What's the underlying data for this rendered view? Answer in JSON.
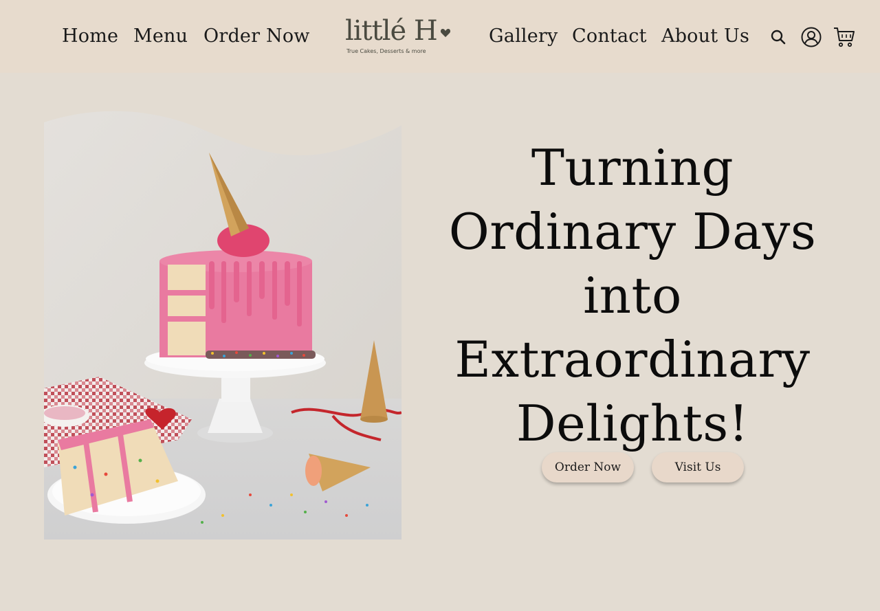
{
  "header": {
    "nav_left": [
      {
        "label": "Home"
      },
      {
        "label": "Menu"
      },
      {
        "label": "Order Now"
      }
    ],
    "nav_right": [
      {
        "label": "Gallery"
      },
      {
        "label": "Contact"
      },
      {
        "label": "About Us"
      }
    ],
    "logo": {
      "wordmark": "littlé H",
      "tagline": "True Cakes, Desserts & more"
    },
    "icons": [
      "search-icon",
      "account-icon",
      "cart-icon"
    ]
  },
  "hero": {
    "title": "Turning Ordinary Days into Extraordinary Delights!",
    "buttons": {
      "order_label": "Order Now",
      "visit_label": "Visit Us"
    }
  },
  "colors": {
    "background": "#e3dcd2",
    "header": "#e7dbcd",
    "button": "#e8d8ca",
    "cake_pink": "#e97aa0",
    "logo": "#4a4a40"
  }
}
